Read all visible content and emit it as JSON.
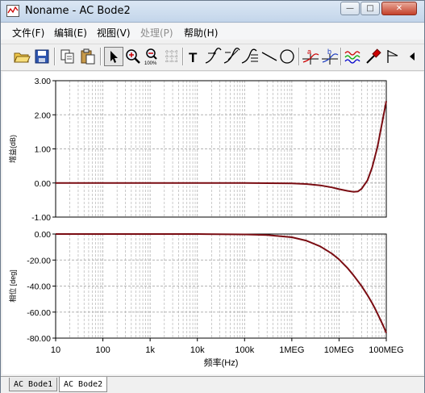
{
  "window": {
    "title": "Noname - AC Bode2",
    "buttons": {
      "minimize": "—",
      "maximize": "□",
      "close": "✕"
    }
  },
  "menu": [
    {
      "label": "文件(F)",
      "enabled": true
    },
    {
      "label": "编辑(E)",
      "enabled": true
    },
    {
      "label": "视图(V)",
      "enabled": true
    },
    {
      "label": "处理(P)",
      "enabled": false
    },
    {
      "label": "帮助(H)",
      "enabled": true
    }
  ],
  "toolbar": {
    "tools": [
      "open-icon",
      "save-icon",
      "copy-icon",
      "paste-icon",
      "pointer-icon",
      "zoom-in-icon",
      "zoom-100-icon",
      "grid-icon",
      "text-icon",
      "label-point-icon",
      "label-slope-icon",
      "label-list-icon",
      "line-icon",
      "ellipse-icon",
      "cursor-a-icon",
      "cursor-b-icon",
      "waveform-icon",
      "probe-icon",
      "marker-icon",
      "scroll-right-icon"
    ],
    "zoom_100_label": "100%",
    "text_tool_label": "T",
    "cursor_a_label": "a",
    "cursor_b_label": "b"
  },
  "colors": {
    "trace": "#7a0c12",
    "grid": "#b4b4b4",
    "axis": "#000000"
  },
  "chart_data": [
    {
      "type": "line",
      "name": "magnitude",
      "ylabel": "增益(dB)",
      "xscale": "log",
      "xlim": [
        10,
        100000000
      ],
      "ylim": [
        -1,
        3
      ],
      "yticks": [
        "3.00",
        "2.00",
        "1.00",
        "0.00",
        "-1.00"
      ],
      "grid": true,
      "series": [
        {
          "x": [
            10,
            100,
            1000,
            10000,
            100000,
            1000000,
            2000000,
            4000000,
            7000000,
            10000000,
            15000000,
            20000000,
            25000000,
            30000000,
            40000000,
            50000000,
            65000000,
            80000000,
            100000000
          ],
          "y": [
            0,
            0,
            0,
            0,
            0,
            -0.01,
            -0.03,
            -0.07,
            -0.13,
            -0.18,
            -0.23,
            -0.26,
            -0.25,
            -0.17,
            0.08,
            0.45,
            1.05,
            1.7,
            2.4
          ]
        }
      ]
    },
    {
      "type": "line",
      "name": "phase",
      "ylabel": "相位 [deg]",
      "xlabel": "频率(Hz)",
      "xscale": "log",
      "xlim": [
        10,
        100000000
      ],
      "ylim": [
        -80,
        0
      ],
      "yticks": [
        "0.00",
        "-20.00",
        "-40.00",
        "-60.00",
        "-80.00"
      ],
      "xticks": [
        "10",
        "100",
        "1k",
        "10k",
        "100k",
        "1MEG",
        "10MEG",
        "100MEG"
      ],
      "grid": true,
      "series": [
        {
          "x": [
            10,
            100,
            1000,
            10000,
            100000,
            300000,
            1000000,
            2000000,
            4000000,
            7000000,
            10000000,
            15000000,
            20000000,
            30000000,
            40000000,
            50000000,
            60000000,
            70000000,
            80000000,
            90000000,
            100000000
          ],
          "y": [
            0,
            0,
            0,
            0,
            -0.3,
            -0.8,
            -2.5,
            -5,
            -9.5,
            -15,
            -19.5,
            -26,
            -31.5,
            -40,
            -47,
            -53,
            -58.5,
            -63.5,
            -68,
            -72,
            -76
          ]
        }
      ]
    }
  ],
  "tabs": [
    {
      "label": "AC Bode1",
      "active": false
    },
    {
      "label": "AC Bode2",
      "active": true
    }
  ]
}
